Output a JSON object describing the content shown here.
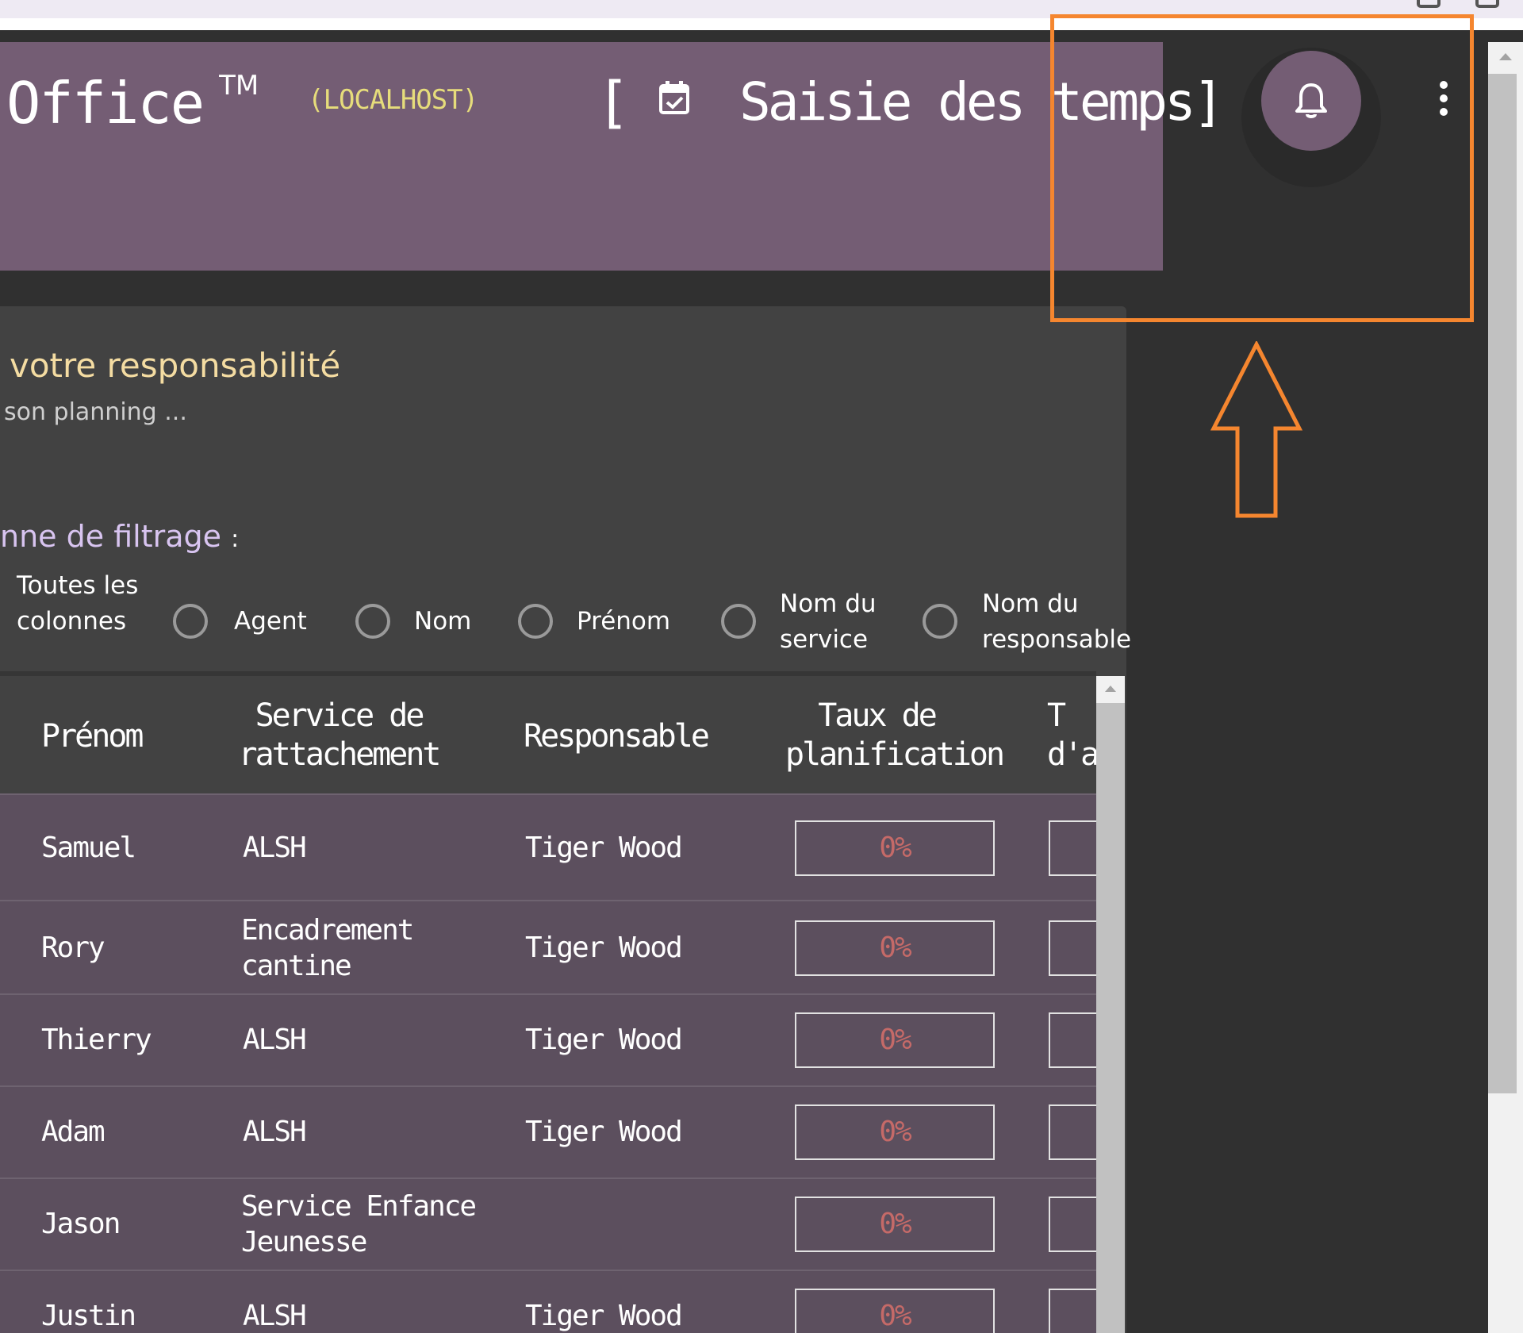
{
  "header": {
    "app_title": "Office",
    "trademark": "TM",
    "environment": "(LOCALHOST)",
    "bracket_open": "[",
    "page_heading": "Saisie des temps]",
    "icons": {
      "calendar": "calendar-check-icon",
      "notifications": "bell-icon",
      "menu": "more-vertical-icon"
    }
  },
  "card": {
    "title": "votre responsabilité",
    "subtitle": "son planning ...",
    "filter_label": "nne de filtrage",
    "filter_colon": ":"
  },
  "filter_options": [
    {
      "label": "Toutes les colonnes"
    },
    {
      "label": "Agent"
    },
    {
      "label": "Nom"
    },
    {
      "label": "Prénom"
    },
    {
      "label": "Nom du service"
    },
    {
      "label": "Nom du responsable"
    }
  ],
  "table": {
    "columns": [
      "Prénom",
      "Service de rattachement",
      "Responsable",
      "Taux de planification",
      "T d'ac"
    ],
    "rows": [
      {
        "prenom": "Samuel",
        "service": "ALSH",
        "responsable": "Tiger Wood",
        "taux": "0%"
      },
      {
        "prenom": "Rory",
        "service": "Encadrement cantine",
        "responsable": "Tiger Wood",
        "taux": "0%"
      },
      {
        "prenom": "Thierry",
        "service": "ALSH",
        "responsable": "Tiger Wood",
        "taux": "0%"
      },
      {
        "prenom": "Adam",
        "service": "ALSH",
        "responsable": "Tiger Wood",
        "taux": "0%"
      },
      {
        "prenom": "Jason",
        "service": "Service Enfance Jeunesse",
        "responsable": "",
        "taux": "0%"
      },
      {
        "prenom": "Justin",
        "service": "ALSH",
        "responsable": "Tiger Wood",
        "taux": "0%"
      }
    ]
  },
  "annotation": {
    "color": "#f5862f"
  }
}
